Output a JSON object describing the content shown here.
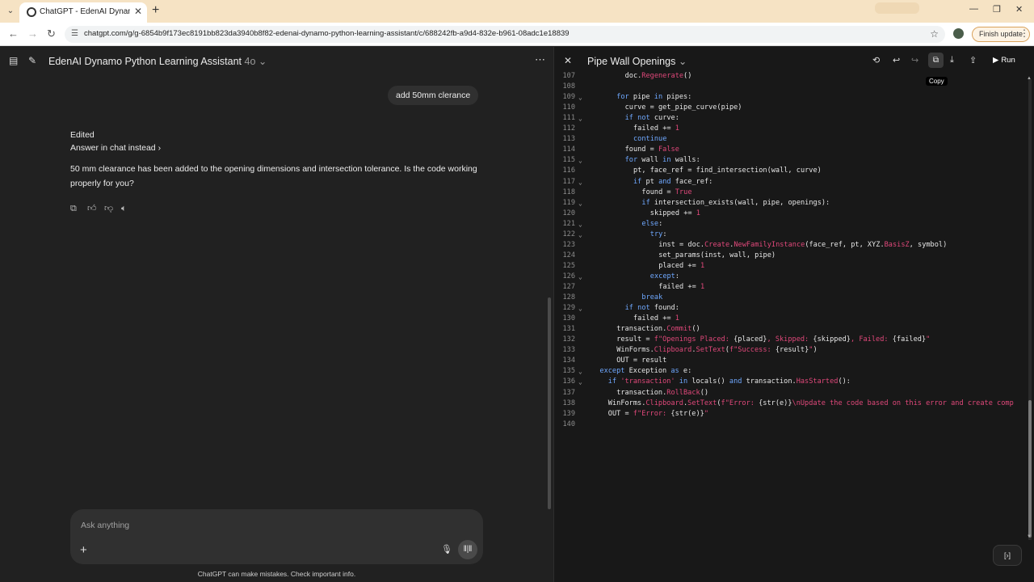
{
  "browser": {
    "tab_title": "ChatGPT - EdenAI Dynamo Pyth",
    "url": "chatgpt.com/g/g-6854b9f173ec8191bb823da3940b8f82-edenai-dynamo-python-learning-assistant/c/688242fb-a9d4-832e-b961-08adc1e18839",
    "finish_update": "Finish update"
  },
  "chat": {
    "title": "EdenAI Dynamo Python Learning Assistant",
    "model": "4o",
    "user_message": "add 50mm clerance",
    "edited_label": "Edited",
    "answer_in_chat": "Answer in chat instead",
    "reply": "50 mm clearance has been added to the opening dimensions and intersection tolerance. Is the code working properly for you?",
    "composer_placeholder": "Ask anything",
    "disclaimer": "ChatGPT can make mistakes. Check important info."
  },
  "canvas": {
    "title": "Pipe Wall Openings",
    "tooltip": "Copy",
    "run_label": "Run",
    "lines": [
      {
        "n": "107",
        "fold": false,
        "indent": 8,
        "segs": [
          [
            "doc.",
            "d"
          ],
          [
            "Regenerate",
            "r"
          ],
          [
            "()",
            "d"
          ]
        ]
      },
      {
        "n": "108",
        "fold": false,
        "indent": 0,
        "segs": []
      },
      {
        "n": "109",
        "fold": true,
        "indent": 6,
        "segs": [
          [
            "for",
            "k"
          ],
          [
            " pipe ",
            "d"
          ],
          [
            "in",
            "k"
          ],
          [
            " pipes:",
            "d"
          ]
        ]
      },
      {
        "n": "110",
        "fold": false,
        "indent": 8,
        "segs": [
          [
            "curve = get_pipe_curve(pipe)",
            "d"
          ]
        ]
      },
      {
        "n": "111",
        "fold": true,
        "indent": 8,
        "segs": [
          [
            "if",
            "k"
          ],
          [
            " ",
            "d"
          ],
          [
            "not",
            "k"
          ],
          [
            " curve:",
            "d"
          ]
        ]
      },
      {
        "n": "112",
        "fold": false,
        "indent": 10,
        "segs": [
          [
            "failed += ",
            "d"
          ],
          [
            "1",
            "r"
          ]
        ]
      },
      {
        "n": "113",
        "fold": false,
        "indent": 10,
        "segs": [
          [
            "continue",
            "k"
          ]
        ]
      },
      {
        "n": "114",
        "fold": false,
        "indent": 8,
        "segs": [
          [
            "found = ",
            "d"
          ],
          [
            "False",
            "r"
          ]
        ]
      },
      {
        "n": "115",
        "fold": true,
        "indent": 8,
        "segs": [
          [
            "for",
            "k"
          ],
          [
            " wall ",
            "d"
          ],
          [
            "in",
            "k"
          ],
          [
            " walls:",
            "d"
          ]
        ]
      },
      {
        "n": "116",
        "fold": false,
        "indent": 10,
        "segs": [
          [
            "pt, face_ref = find_intersection(wall, curve)",
            "d"
          ]
        ]
      },
      {
        "n": "117",
        "fold": true,
        "indent": 10,
        "segs": [
          [
            "if",
            "k"
          ],
          [
            " pt ",
            "d"
          ],
          [
            "and",
            "k"
          ],
          [
            " face_ref:",
            "d"
          ]
        ]
      },
      {
        "n": "118",
        "fold": false,
        "indent": 12,
        "segs": [
          [
            "found = ",
            "d"
          ],
          [
            "True",
            "r"
          ]
        ]
      },
      {
        "n": "119",
        "fold": true,
        "indent": 12,
        "segs": [
          [
            "if",
            "k"
          ],
          [
            " intersection_exists(wall, pipe, openings):",
            "d"
          ]
        ]
      },
      {
        "n": "120",
        "fold": false,
        "indent": 14,
        "segs": [
          [
            "skipped += ",
            "d"
          ],
          [
            "1",
            "r"
          ]
        ]
      },
      {
        "n": "121",
        "fold": true,
        "indent": 12,
        "segs": [
          [
            "else",
            "k"
          ],
          [
            ":",
            "d"
          ]
        ]
      },
      {
        "n": "122",
        "fold": true,
        "indent": 14,
        "segs": [
          [
            "try",
            "k"
          ],
          [
            ":",
            "d"
          ]
        ]
      },
      {
        "n": "123",
        "fold": false,
        "indent": 16,
        "segs": [
          [
            "inst = doc.",
            "d"
          ],
          [
            "Create",
            "r"
          ],
          [
            ".",
            "d"
          ],
          [
            "NewFamilyInstance",
            "r"
          ],
          [
            "(face_ref, pt, XYZ.",
            "d"
          ],
          [
            "BasisZ",
            "r"
          ],
          [
            ", symbol)",
            "d"
          ]
        ]
      },
      {
        "n": "124",
        "fold": false,
        "indent": 16,
        "segs": [
          [
            "set_params(inst, wall, pipe)",
            "d"
          ]
        ]
      },
      {
        "n": "125",
        "fold": false,
        "indent": 16,
        "segs": [
          [
            "placed += ",
            "d"
          ],
          [
            "1",
            "r"
          ]
        ]
      },
      {
        "n": "126",
        "fold": true,
        "indent": 14,
        "segs": [
          [
            "except",
            "k"
          ],
          [
            ":",
            "d"
          ]
        ]
      },
      {
        "n": "127",
        "fold": false,
        "indent": 16,
        "segs": [
          [
            "failed += ",
            "d"
          ],
          [
            "1",
            "r"
          ]
        ]
      },
      {
        "n": "128",
        "fold": false,
        "indent": 12,
        "segs": [
          [
            "break",
            "k"
          ]
        ]
      },
      {
        "n": "129",
        "fold": true,
        "indent": 8,
        "segs": [
          [
            "if",
            "k"
          ],
          [
            " ",
            "d"
          ],
          [
            "not",
            "k"
          ],
          [
            " found:",
            "d"
          ]
        ]
      },
      {
        "n": "130",
        "fold": false,
        "indent": 10,
        "segs": [
          [
            "failed += ",
            "d"
          ],
          [
            "1",
            "r"
          ]
        ]
      },
      {
        "n": "131",
        "fold": false,
        "indent": 6,
        "segs": [
          [
            "transaction.",
            "d"
          ],
          [
            "Commit",
            "r"
          ],
          [
            "()",
            "d"
          ]
        ]
      },
      {
        "n": "132",
        "fold": false,
        "indent": 6,
        "segs": [
          [
            "result = ",
            "d"
          ],
          [
            "f\"Openings Placed: ",
            "r"
          ],
          [
            "{placed}",
            "d"
          ],
          [
            ", Skipped: ",
            "r"
          ],
          [
            "{skipped}",
            "d"
          ],
          [
            ", Failed: ",
            "r"
          ],
          [
            "{failed}",
            "d"
          ],
          [
            "\"",
            "r"
          ]
        ]
      },
      {
        "n": "133",
        "fold": false,
        "indent": 6,
        "segs": [
          [
            "WinForms.",
            "d"
          ],
          [
            "Clipboard",
            "r"
          ],
          [
            ".",
            "d"
          ],
          [
            "SetText",
            "r"
          ],
          [
            "(",
            "d"
          ],
          [
            "f\"Success: ",
            "r"
          ],
          [
            "{result}",
            "d"
          ],
          [
            "\"",
            "r"
          ],
          [
            ")",
            "d"
          ]
        ]
      },
      {
        "n": "134",
        "fold": false,
        "indent": 6,
        "segs": [
          [
            "OUT = result",
            "d"
          ]
        ]
      },
      {
        "n": "135",
        "fold": true,
        "indent": 2,
        "segs": [
          [
            "except",
            "k"
          ],
          [
            " Exception ",
            "d"
          ],
          [
            "as",
            "k"
          ],
          [
            " e:",
            "d"
          ]
        ]
      },
      {
        "n": "136",
        "fold": true,
        "indent": 4,
        "segs": [
          [
            "if",
            "k"
          ],
          [
            " ",
            "d"
          ],
          [
            "'transaction'",
            "r"
          ],
          [
            " ",
            "d"
          ],
          [
            "in",
            "k"
          ],
          [
            " locals() ",
            "d"
          ],
          [
            "and",
            "k"
          ],
          [
            " transaction.",
            "d"
          ],
          [
            "HasStarted",
            "r"
          ],
          [
            "():",
            "d"
          ]
        ]
      },
      {
        "n": "137",
        "fold": false,
        "indent": 6,
        "segs": [
          [
            "transaction.",
            "d"
          ],
          [
            "RollBack",
            "r"
          ],
          [
            "()",
            "d"
          ]
        ]
      },
      {
        "n": "138",
        "fold": false,
        "indent": 4,
        "segs": [
          [
            "WinForms.",
            "d"
          ],
          [
            "Clipboard",
            "r"
          ],
          [
            ".",
            "d"
          ],
          [
            "SetText",
            "r"
          ],
          [
            "(",
            "d"
          ],
          [
            "f\"Error: ",
            "r"
          ],
          [
            "{str(e)}",
            "d"
          ],
          [
            "\\nUpdate the code based on this error and create comp",
            "r"
          ]
        ]
      },
      {
        "n": "139",
        "fold": false,
        "indent": 4,
        "segs": [
          [
            "OUT = ",
            "d"
          ],
          [
            "f\"Error: ",
            "r"
          ],
          [
            "{str(e)}",
            "d"
          ],
          [
            "\"",
            "r"
          ]
        ]
      },
      {
        "n": "140",
        "fold": false,
        "indent": 0,
        "segs": []
      }
    ]
  }
}
